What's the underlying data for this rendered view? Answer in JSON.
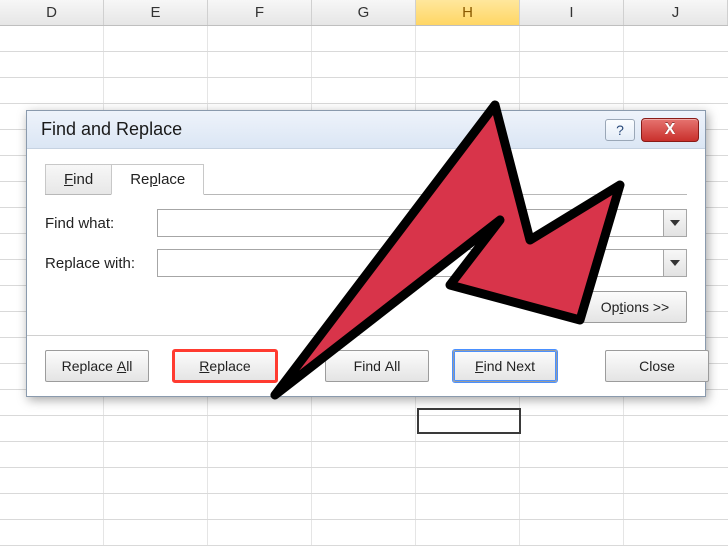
{
  "spreadsheet": {
    "columns": [
      "D",
      "E",
      "F",
      "G",
      "H",
      "I",
      "J"
    ],
    "selected_column": "H"
  },
  "dialog": {
    "title": "Find and Replace",
    "help_glyph": "?",
    "close_glyph": "X",
    "tabs": {
      "find": "Find",
      "replace": "Replace"
    },
    "labels": {
      "find_what": "Find what:",
      "replace_with": "Replace with:"
    },
    "inputs": {
      "find_what_value": "",
      "replace_with_value": ""
    },
    "options_button": "Options >>",
    "buttons": {
      "replace_all": "Replace All",
      "replace": "Replace",
      "find_all": "Find All",
      "find_next": "Find Next",
      "close": "Close"
    }
  }
}
